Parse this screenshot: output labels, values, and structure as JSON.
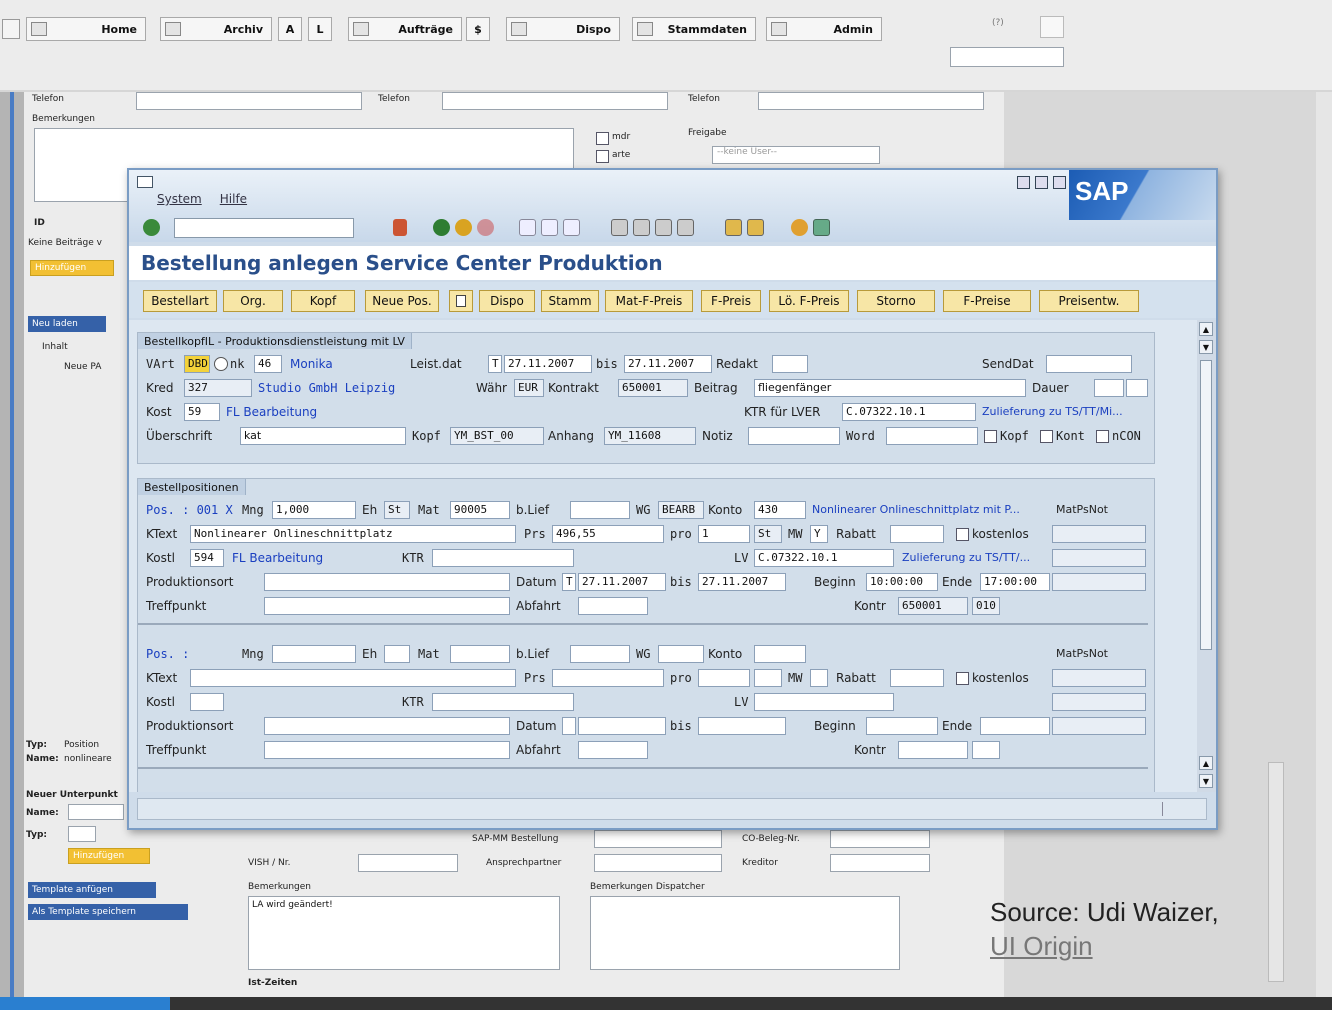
{
  "topnav": {
    "home": "Home",
    "archiv": "Archiv",
    "a": "A",
    "l": "L",
    "auftraege": "Aufträge",
    "dollar": "$",
    "dispo": "Dispo",
    "stammdaten": "Stammdaten",
    "admin": "Admin",
    "help": "(?)"
  },
  "bg": {
    "telefon1": "Telefon",
    "telefon2": "Telefon",
    "telefon3": "Telefon",
    "bemerkungen": "Bemerkungen",
    "mdr": "mdr",
    "arte": "arte",
    "freigabe": "Freigabe",
    "keine_user": "--keine User--",
    "id": "ID",
    "keine_beitraege": "Keine Beiträge v",
    "hinzufuegen": "Hinzufügen",
    "neu_laden": "Neu laden",
    "inhalt": "Inhalt",
    "neue_pa": "Neue PA",
    "typ": "Typ:",
    "positionen": "Position",
    "name": "Name:",
    "nonlinear": "nonlineare",
    "neuer_unterpunkt": "Neuer Unterpunkt",
    "name2": "Name:",
    "typ2": "Typ:",
    "hinzufuegen2": "Hinzufügen",
    "template_anfuegen": "Template anfügen",
    "als_template": "Als Template speichern",
    "sapmm": "SAP-MM Bestellung",
    "cobeleg": "CO-Beleg-Nr.",
    "vish": "VISH / Nr.",
    "ansprechpartner": "Ansprechpartner",
    "kreditor": "Kreditor",
    "bemerkungen2": "Bemerkungen",
    "la_text": "LA wird geändert!",
    "bem_dispatcher": "Bemerkungen Dispatcher",
    "ist_zeiten": "Ist-Zeiten"
  },
  "sap": {
    "menu": [
      "System",
      "Hilfe"
    ],
    "logo": "SAP",
    "title": "Bestellung anlegen Service Center Produktion",
    "buttons": [
      "Bestellart",
      "Org.",
      "Kopf",
      "Neue Pos.",
      "",
      "Dispo",
      "Stamm",
      "Mat-F-Preis",
      "F-Preis",
      "Lö. F-Preis",
      "Storno",
      "F-Preise",
      "Preisentw."
    ],
    "kopf": {
      "header": "BestellkopfIL - Produktionsdienstleistung mit LV",
      "vart": "VArt",
      "vart_val": "DBD",
      "ank": "nk",
      "ank_val": "46",
      "ank_name": "Monika",
      "leistdat": "Leist.dat",
      "t": "T",
      "von": "27.11.2007",
      "bis_lbl": "bis",
      "bis": "27.11.2007",
      "redakt": "Redakt",
      "senddat": "SendDat",
      "kred": "Kred",
      "kred_val": "327",
      "kred_name": "Studio GmbH  Leipzig",
      "waehr": "Währ",
      "waehr_val": "EUR",
      "kontrakt": "Kontrakt",
      "kontrakt_val": "650001",
      "beitrag": "Beitrag",
      "beitrag_val": "fliegenfänger",
      "dauer": "Dauer",
      "kost": "Kost",
      "kost_val": "59",
      "kost_name": "FL Bearbeitung",
      "ktr": "KTR für LVER",
      "ktr_val": "C.07322.10.1",
      "zulief": "Zulieferung zu TS/TT/Mi...",
      "ueberschrift": "Überschrift",
      "ueber_val": "kat",
      "kopf": "Kopf",
      "kopf_val": "YM_BST_00",
      "anhang": "Anhang",
      "anhang_val": "YM_11608",
      "notiz": "Notiz",
      "word": "Word",
      "kopf_cb": "Kopf",
      "kont_cb": "Kont",
      "ncon_cb": "nCON"
    },
    "pos": {
      "header": "Bestellpositionen",
      "pos1": "Pos. : 001 X",
      "mng": "Mng",
      "mng_val": "1,000",
      "eh": "Eh",
      "eh_val": "St",
      "mat": "Mat",
      "mat_val": "90005",
      "blief": "b.Lief",
      "wg": "WG",
      "wg_val": "BEARB",
      "konto": "Konto",
      "konto_val": "430",
      "nonlin": "Nonlinearer Onlineschnittplatz mit P...",
      "matpsnot": "MatPsNot",
      "ktext": "KText",
      "ktext_val": "Nonlinearer Onlineschnittplatz",
      "prs": "Prs",
      "prs_val": "496,55",
      "pro": "pro",
      "pro_val": "1",
      "pro_unit": "St",
      "mw": "MW",
      "mw_val": "Y",
      "rabatt": "Rabatt",
      "kostenlos": "kostenlos",
      "kostl": "Kostl",
      "kostl_val": "594",
      "kostl_name": "FL Bearbeitung",
      "ktr": "KTR",
      "lv": "LV",
      "lv_val": "C.07322.10.1",
      "zulief": "Zulieferung zu TS/TT/...",
      "prodort": "Produktionsort",
      "datum": "Datum",
      "datum_t": "T",
      "datum_val": "27.11.2007",
      "bis": "bis",
      "bis_val": "27.11.2007",
      "beginn": "Beginn",
      "beginn_val": "10:00:00",
      "ende": "Ende",
      "ende_val": "17:00:00",
      "treffpunkt": "Treffpunkt",
      "abfahrt": "Abfahrt",
      "kontr": "Kontr",
      "kontr_val": "650001",
      "kontr_pos": "010",
      "pos2": "Pos. :",
      "mng2": "Mng",
      "eh2": "Eh",
      "mat2": "Mat",
      "blief2": "b.Lief",
      "wg2": "WG",
      "konto2": "Konto",
      "matpsnot2": "MatPsNot",
      "ktext2": "KText",
      "prs2": "Prs",
      "pro2": "pro",
      "mw2": "MW",
      "rabatt2": "Rabatt",
      "kostenlos2": "kostenlos",
      "kostl2": "Kostl",
      "ktr2": "KTR",
      "lv2": "LV",
      "prodort2": "Produktionsort",
      "datum2": "Datum",
      "bis2": "bis",
      "beginn2": "Beginn",
      "ende2": "Ende",
      "treffpunkt2": "Treffpunkt",
      "abfahrt2": "Abfahrt",
      "kontr2": "Kontr"
    }
  },
  "source": {
    "line1": "Source: Udi Waizer,",
    "line2": "UI Origin"
  }
}
